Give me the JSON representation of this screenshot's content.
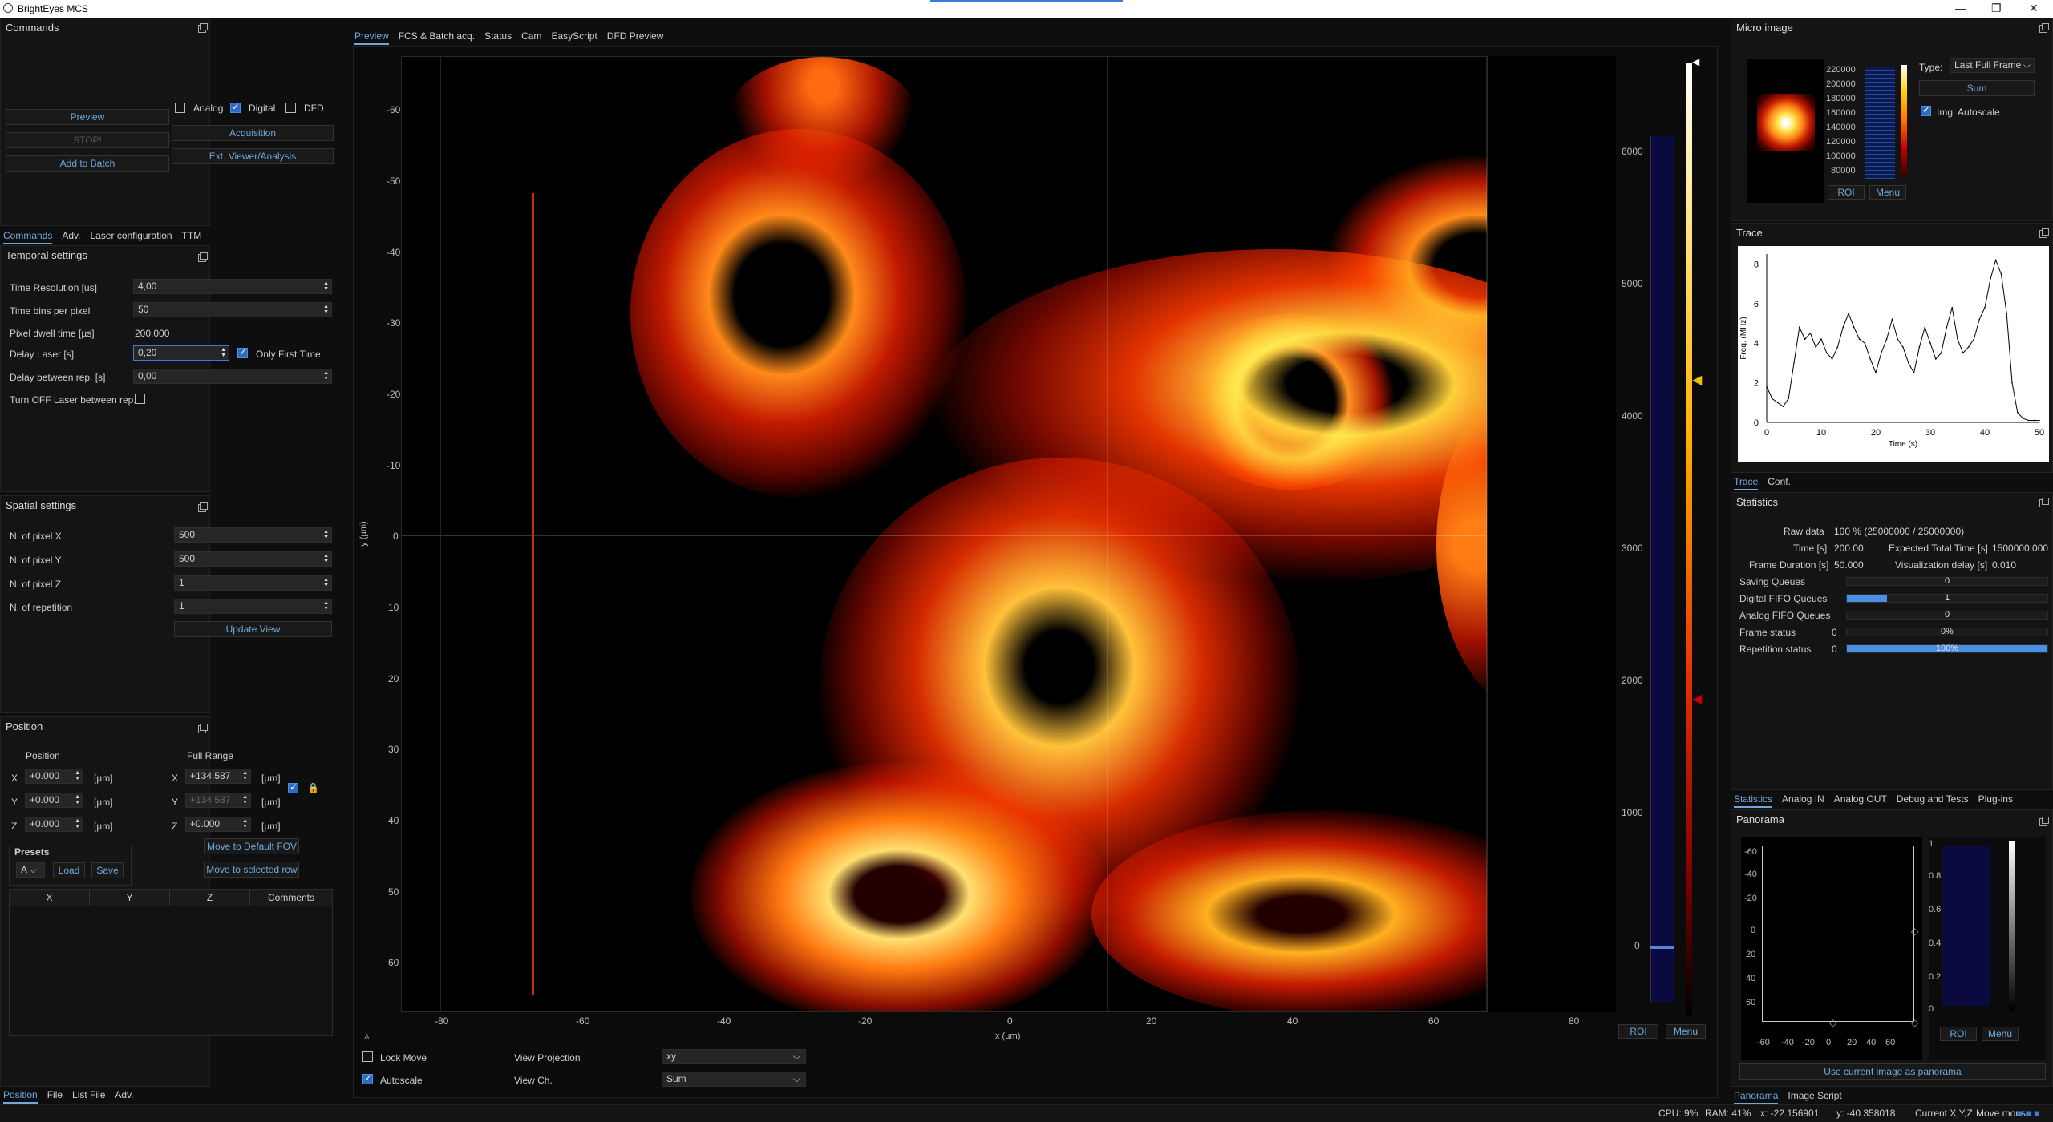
{
  "window": {
    "title": "BrightEyes MCS"
  },
  "commands": {
    "title": "Commands",
    "preview_label": "Preview",
    "analog_label": "Analog",
    "analog_checked": false,
    "digital_label": "Digital",
    "digital_checked": true,
    "dfd_label": "DFD",
    "dfd_checked": false,
    "stop_label": "STOP!",
    "acquisition_label": "Acquisition",
    "add_batch_label": "Add to Batch",
    "ext_viewer_label": "Ext. Viewer/Analysis"
  },
  "left_tabs": {
    "items": [
      "Commands",
      "Adv.",
      "Laser configuration",
      "TTM"
    ],
    "active": 0
  },
  "temporal": {
    "title": "Temporal settings",
    "time_resolution_label": "Time Resolution [us]",
    "time_resolution_value": "4,00",
    "time_bins_label": "Time bins per pixel",
    "time_bins_value": "50",
    "dwell_label": "Pixel dwell time [µs]",
    "dwell_value": "200.000",
    "delay_laser_label": "Delay Laser [s]",
    "delay_laser_value": "0,20",
    "only_first_label": "Only First Time",
    "only_first_checked": true,
    "delay_rep_label": "Delay between rep. [s]",
    "delay_rep_value": "0,00",
    "turn_off_label": "Turn OFF Laser between rep.",
    "turn_off_checked": false
  },
  "spatial": {
    "title": "Spatial settings",
    "npx_label": "N. of pixel X",
    "npx_value": "500",
    "npy_label": "N. of pixel Y",
    "npy_value": "500",
    "npz_label": "N. of pixel Z",
    "npz_value": "1",
    "nrep_label": "N. of repetition",
    "nrep_value": "1",
    "update_label": "Update View"
  },
  "position": {
    "title": "Position",
    "position_label": "Position",
    "full_range_label": "Full Range",
    "x_label": "X",
    "y_label": "Y",
    "z_label": "Z",
    "unit": "[µm]",
    "pos_x": "+0.000",
    "pos_y": "+0.000",
    "pos_z": "+0.000",
    "range_x": "+134.587",
    "range_y": "+134.587",
    "range_z": "+0.000",
    "lock_checked": true,
    "presets_label": "Presets",
    "preset_value": "A",
    "load_label": "Load",
    "save_label": "Save",
    "default_fov_label": "Move to Default FOV",
    "selected_row_label": "Move to selected row",
    "table_headers": [
      "X",
      "Y",
      "Z",
      "Comments"
    ]
  },
  "bottom_left_tabs": {
    "items": [
      "Position",
      "File",
      "List File",
      "Adv."
    ],
    "active": 0
  },
  "center_tabs": {
    "items": [
      "Preview",
      "FCS & Batch acq.",
      "Status",
      "Cam",
      "EasyScript",
      "DFD Preview"
    ],
    "active": 0
  },
  "main_plot": {
    "xlabel": "x (µm)",
    "ylabel": "y (µm)",
    "x_ticks": [
      "-80",
      "-60",
      "-40",
      "-20",
      "0",
      "20",
      "40",
      "60",
      "80"
    ],
    "y_ticks": [
      "-60",
      "-50",
      "-40",
      "-30",
      "-20",
      "-10",
      "0",
      "10",
      "20",
      "30",
      "40",
      "50",
      "60"
    ],
    "colorbar_ticks": [
      "6000",
      "5000",
      "4000",
      "3000",
      "2000",
      "1000",
      "0"
    ],
    "roi_label": "ROI",
    "menu_label": "Menu"
  },
  "view_controls": {
    "lock_move_label": "Lock Move",
    "lock_move_checked": false,
    "autoscale_label": "Autoscale",
    "autoscale_checked": true,
    "projection_label": "View Projection",
    "projection_value": "xy",
    "channel_label": "View Ch.",
    "channel_value": "Sum"
  },
  "micro_image": {
    "title": "Micro image",
    "ticks": [
      "220000",
      "200000",
      "180000",
      "160000",
      "140000",
      "120000",
      "100000",
      "80000"
    ],
    "type_label": "Type:",
    "type_value": "Last Full Frame",
    "sum_label": "Sum",
    "img_autoscale_label": "Img. Autoscale",
    "img_autoscale_checked": true,
    "roi_label": "ROI",
    "menu_label": "Menu"
  },
  "trace": {
    "title": "Trace",
    "ylabel": "Freq. (MHz)",
    "xlabel": "Time (s)",
    "x_ticks": [
      "0",
      "10",
      "20",
      "30",
      "40",
      "50"
    ],
    "y_ticks": [
      "0",
      "2",
      "4",
      "6",
      "8"
    ]
  },
  "chart_data": {
    "type": "line",
    "xlabel": "Time (s)",
    "ylabel": "Freq. (MHz)",
    "xlim": [
      0,
      50
    ],
    "ylim": [
      0,
      8.5
    ],
    "x": [
      0,
      1,
      2,
      3,
      4,
      5,
      6,
      7,
      8,
      9,
      10,
      11,
      12,
      13,
      14,
      15,
      16,
      17,
      18,
      19,
      20,
      21,
      22,
      23,
      24,
      25,
      26,
      27,
      28,
      29,
      30,
      31,
      32,
      33,
      34,
      35,
      36,
      37,
      38,
      39,
      40,
      41,
      42,
      43,
      44,
      45,
      46,
      47,
      48,
      49,
      50
    ],
    "values": [
      1.8,
      1.2,
      1.0,
      0.8,
      1.2,
      3.0,
      4.8,
      4.2,
      4.5,
      3.8,
      4.2,
      3.5,
      3.2,
      3.8,
      4.8,
      5.5,
      4.8,
      4.2,
      4.0,
      3.2,
      2.5,
      3.5,
      4.2,
      5.2,
      4.2,
      3.8,
      3.0,
      2.5,
      3.8,
      4.8,
      4.0,
      3.2,
      3.5,
      4.8,
      5.8,
      4.2,
      3.5,
      3.8,
      4.2,
      5.2,
      5.8,
      7.2,
      8.2,
      7.5,
      5.5,
      2.0,
      0.5,
      0.2,
      0.1,
      0.1,
      0.1
    ]
  },
  "trace_tabs": {
    "items": [
      "Trace",
      "Conf."
    ],
    "active": 0
  },
  "statistics": {
    "title": "Statistics",
    "raw_data_label": "Raw data",
    "raw_data_value": "100 % (25000000 / 25000000)",
    "time_label": "Time [s]",
    "time_value": "200.00",
    "exp_total_label": "Expected Total Time [s]",
    "exp_total_value": "1500000.000",
    "frame_dur_label": "Frame Duration [s]",
    "frame_dur_value": "50.000",
    "vis_delay_label": "Visualization delay [s]",
    "vis_delay_value": "0.010",
    "saving_label": "Saving Queues",
    "saving_value": "0",
    "saving_frac": 0,
    "digital_label": "Digital FIFO Queues",
    "digital_value": "1",
    "digital_frac": 0.2,
    "analog_label": "Analog FIFO Queues",
    "analog_value": "0",
    "analog_frac": 0,
    "frame_label": "Frame status",
    "frame_count": "0",
    "frame_text": "0%",
    "frame_frac": 0,
    "rep_label": "Repetition status",
    "rep_count": "0",
    "rep_text": "100%",
    "rep_frac": 1.0
  },
  "stats_tabs": {
    "items": [
      "Statistics",
      "Analog IN",
      "Analog OUT",
      "Debug and Tests",
      "Plug-ins"
    ],
    "active": 0
  },
  "panorama": {
    "title": "Panorama",
    "y_ticks": [
      "-60",
      "-40",
      "-20",
      "0",
      "20",
      "40",
      "60"
    ],
    "x_ticks": [
      "-60",
      "-40",
      "-20",
      "0",
      "20",
      "40",
      "60"
    ],
    "cbar_ticks": [
      "1",
      "0.8",
      "0.6",
      "0.4",
      "0.2",
      "0"
    ],
    "roi_label": "ROI",
    "menu_label": "Menu",
    "use_current_label": "Use current image as panorama"
  },
  "panorama_tabs": {
    "items": [
      "Panorama",
      "Image Script"
    ],
    "active": 0
  },
  "statusbar": {
    "cpu": "CPU: 9%",
    "ram": "RAM: 41%",
    "x": "x: -22.156901",
    "y": "y: -40.358018",
    "current": "Current X,Y,Z",
    "move": "Move mouse"
  }
}
